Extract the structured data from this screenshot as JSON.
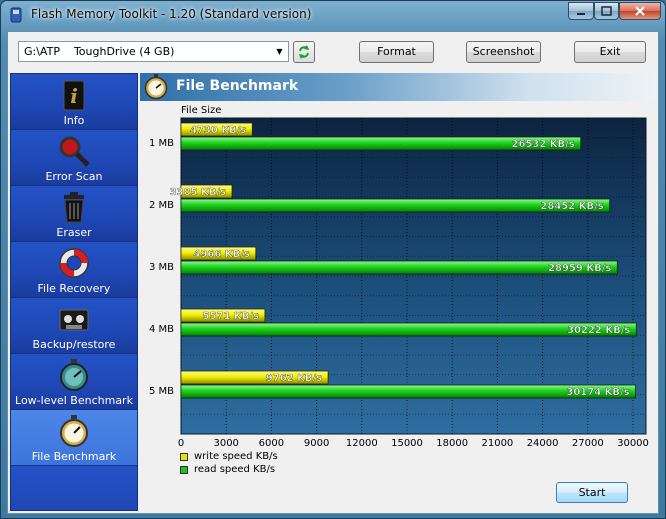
{
  "window": {
    "title": "Flash Memory Toolkit - 1.20 (Standard version)",
    "controls": [
      "minimize",
      "maximize",
      "close"
    ]
  },
  "toolbar": {
    "device": "G:\\ATP    ToughDrive (4 GB)",
    "format_label": "Format",
    "screenshot_label": "Screenshot",
    "exit_label": "Exit"
  },
  "sidebar": {
    "items": [
      {
        "label": "Info",
        "icon": "info-icon"
      },
      {
        "label": "Error Scan",
        "icon": "magnifier-icon"
      },
      {
        "label": "Eraser",
        "icon": "trash-icon"
      },
      {
        "label": "File Recovery",
        "icon": "lifebuoy-icon"
      },
      {
        "label": "Backup/restore",
        "icon": "tape-icon"
      },
      {
        "label": "Low-level Benchmark",
        "icon": "stopwatch-icon"
      },
      {
        "label": "File Benchmark",
        "icon": "stopwatch-icon",
        "active": true
      }
    ]
  },
  "panel": {
    "title": "File Benchmark",
    "start_label": "Start"
  },
  "colors": {
    "write": "#f2ef00",
    "read": "#19d419",
    "plot_bg": "#123a62"
  },
  "chart_data": {
    "type": "bar",
    "orientation": "horizontal",
    "categories": [
      "1 MB",
      "2 MB",
      "3 MB",
      "4 MB",
      "5 MB"
    ],
    "ylabel": "File Size",
    "xlim": [
      0,
      30000
    ],
    "xticks": [
      0,
      3000,
      6000,
      9000,
      12000,
      15000,
      18000,
      21000,
      24000,
      27000,
      30000
    ],
    "grid": true,
    "legend_position": "bottom-left",
    "series": [
      {
        "name": "write speed KB/s",
        "values": [
          4730,
          3385,
          4966,
          5571,
          9762
        ],
        "labels": [
          "4730 KB/s",
          "3385 KB/s",
          "4966 KB/s",
          "5571 KB/s",
          "9762 KB/s"
        ]
      },
      {
        "name": "read speed KB/s",
        "values": [
          26532,
          28452,
          28959,
          30222,
          30174
        ],
        "labels": [
          "26532 KB/s",
          "28452 KB/s",
          "28959 KB/s",
          "30222 KB/s",
          "30174 KB/s"
        ]
      }
    ]
  }
}
